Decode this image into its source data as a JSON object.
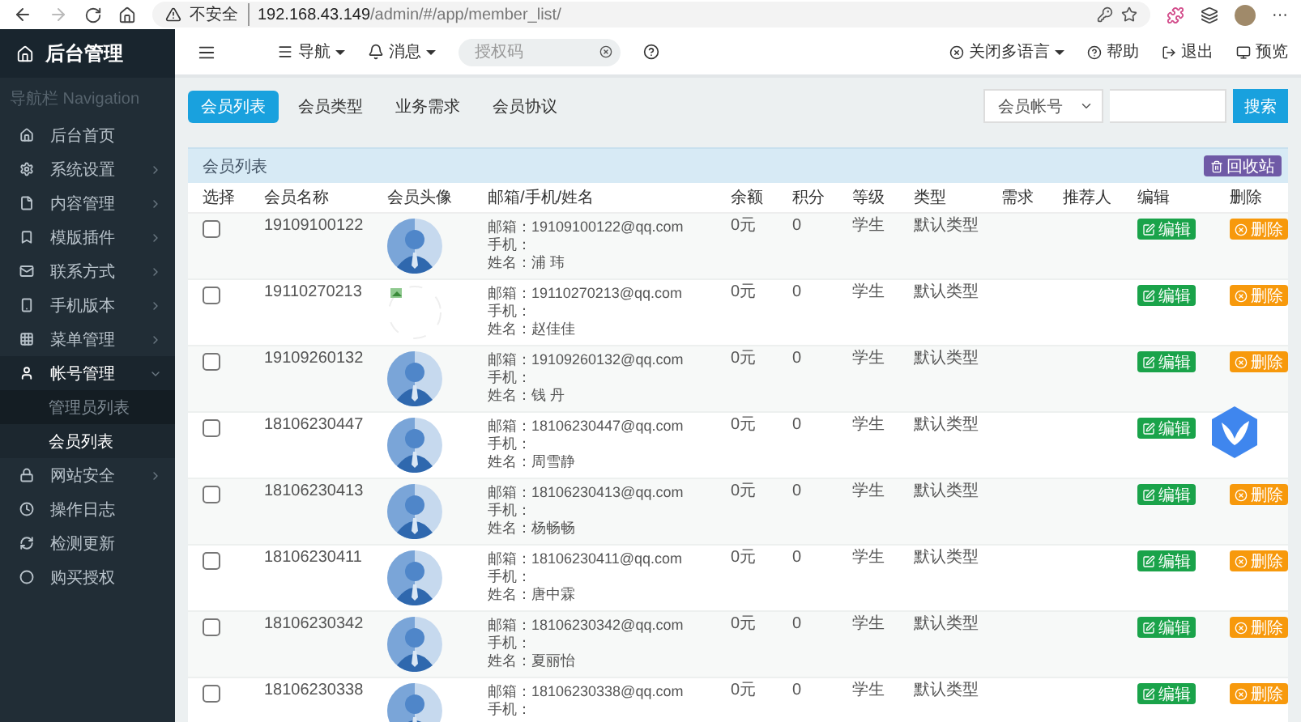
{
  "browser": {
    "security": "不安全",
    "url_host": "192.168.43.149",
    "url_path": "/admin/#/app/member_list/",
    "menu": "···"
  },
  "brand": "后台管理",
  "topnav": {
    "nav": "导航",
    "messages": "消息",
    "search": {
      "placeholder": "授权码"
    },
    "language": "关闭多语言",
    "help": "帮助",
    "logout": "退出",
    "preview": "预览"
  },
  "sidebar": {
    "heading": "导航栏 Navigation",
    "items": [
      {
        "label": "后台首页"
      },
      {
        "label": "系统设置",
        "expanded": false
      },
      {
        "label": "内容管理",
        "expanded": false
      },
      {
        "label": "模版插件",
        "expanded": false
      },
      {
        "label": "联系方式",
        "expanded": false
      },
      {
        "label": "手机版本",
        "expanded": false
      },
      {
        "label": "菜单管理",
        "expanded": false
      },
      {
        "label": "帐号管理",
        "expanded": true,
        "children": [
          {
            "label": "管理员列表",
            "selected": false
          },
          {
            "label": "会员列表",
            "selected": true
          }
        ]
      },
      {
        "label": "网站安全",
        "expanded": false
      },
      {
        "label": "操作日志"
      },
      {
        "label": "检测更新"
      },
      {
        "label": "购买授权"
      }
    ]
  },
  "tabs": [
    {
      "label": "会员列表",
      "selected": true
    },
    {
      "label": "会员类型",
      "selected": false
    },
    {
      "label": "业务需求",
      "selected": false
    },
    {
      "label": "会员协议",
      "selected": false
    }
  ],
  "filter": {
    "field": "会员帐号",
    "button": "搜索"
  },
  "panel": {
    "title": "会员列表",
    "recycle": "回收站"
  },
  "table": {
    "columns": [
      "选择",
      "会员名称",
      "会员头像",
      "邮箱/手机/姓名",
      "余额",
      "积分",
      "等级",
      "类型",
      "需求",
      "推荐人",
      "编辑",
      "删除"
    ],
    "rows": [
      {
        "checked": false,
        "name": "19109100122",
        "avatar": {
          "kind": "person"
        },
        "email": "邮箱：19109100122@qq.com",
        "phone": "手机：",
        "realname": "姓名：浦 玮",
        "balance": "0元",
        "points": "0",
        "level": "学生",
        "type": "默认类型",
        "edit": "编辑",
        "delete": "删除"
      },
      {
        "checked": false,
        "name": "19110270213",
        "avatar": {
          "kind": "broken"
        },
        "email": "邮箱：19110270213@qq.com",
        "phone": "手机：",
        "realname": "姓名：赵佳佳",
        "balance": "0元",
        "points": "0",
        "level": "学生",
        "type": "默认类型",
        "edit": "编辑",
        "delete": "删除"
      },
      {
        "checked": false,
        "name": "19109260132",
        "avatar": {
          "kind": "person"
        },
        "email": "邮箱：19109260132@qq.com",
        "phone": "手机：",
        "realname": "姓名：钱 丹",
        "balance": "0元",
        "points": "0",
        "level": "学生",
        "type": "默认类型",
        "edit": "编辑",
        "delete": "删除"
      },
      {
        "checked": false,
        "name": "18106230447",
        "avatar": {
          "kind": "person"
        },
        "email": "邮箱：18106230447@qq.com",
        "phone": "手机：",
        "realname": "姓名：周雪静",
        "balance": "0元",
        "points": "0",
        "level": "学生",
        "type": "默认类型",
        "edit": "编辑"
      },
      {
        "checked": false,
        "name": "18106230413",
        "avatar": {
          "kind": "person"
        },
        "email": "邮箱：18106230413@qq.com",
        "phone": "手机：",
        "realname": "姓名：杨畅畅",
        "balance": "0元",
        "points": "0",
        "level": "学生",
        "type": "默认类型",
        "edit": "编辑",
        "delete": "删除"
      },
      {
        "checked": false,
        "name": "18106230411",
        "avatar": {
          "kind": "person"
        },
        "email": "邮箱：18106230411@qq.com",
        "phone": "手机：",
        "realname": "姓名：唐中霖",
        "balance": "0元",
        "points": "0",
        "level": "学生",
        "type": "默认类型",
        "edit": "编辑",
        "delete": "删除"
      },
      {
        "checked": false,
        "name": "18106230342",
        "avatar": {
          "kind": "person"
        },
        "email": "邮箱：18106230342@qq.com",
        "phone": "手机：",
        "realname": "姓名：夏丽怡",
        "balance": "0元",
        "points": "0",
        "level": "学生",
        "type": "默认类型",
        "edit": "编辑",
        "delete": "删除"
      },
      {
        "checked": false,
        "name": "18106230338",
        "avatar": {
          "kind": "person"
        },
        "email": "邮箱：18106230338@qq.com",
        "phone": "手机：",
        "balance": "0元",
        "points": "0",
        "level": "学生",
        "type": "默认类型",
        "edit": "编辑",
        "delete": "删除"
      }
    ]
  }
}
